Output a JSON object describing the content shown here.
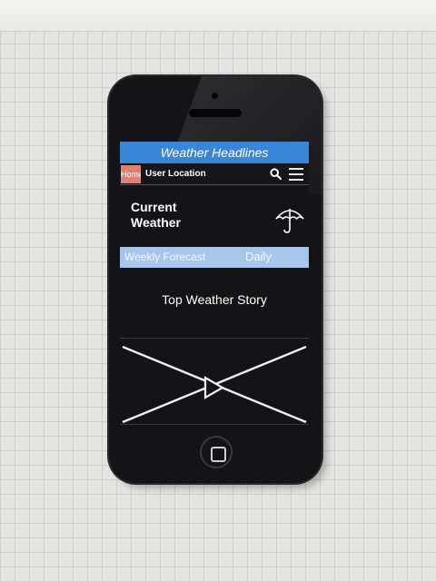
{
  "app": {
    "title": "Weather Headlines"
  },
  "nav": {
    "home_label": "Home",
    "location_label": "User Location",
    "icons": [
      "search-icon",
      "menu-icon"
    ]
  },
  "current": {
    "label": "Current Weather",
    "icon": "umbrella-icon"
  },
  "forecast": {
    "tabs": [
      {
        "label": "Weekly Forecast"
      },
      {
        "label": "Daily"
      }
    ]
  },
  "story": {
    "label": "Top Weather Story"
  },
  "colors": {
    "title_bar": "#3a86d6",
    "home_button": "#e08070",
    "forecast_bar": "#a8c6ec",
    "screen_background": "#141418"
  }
}
